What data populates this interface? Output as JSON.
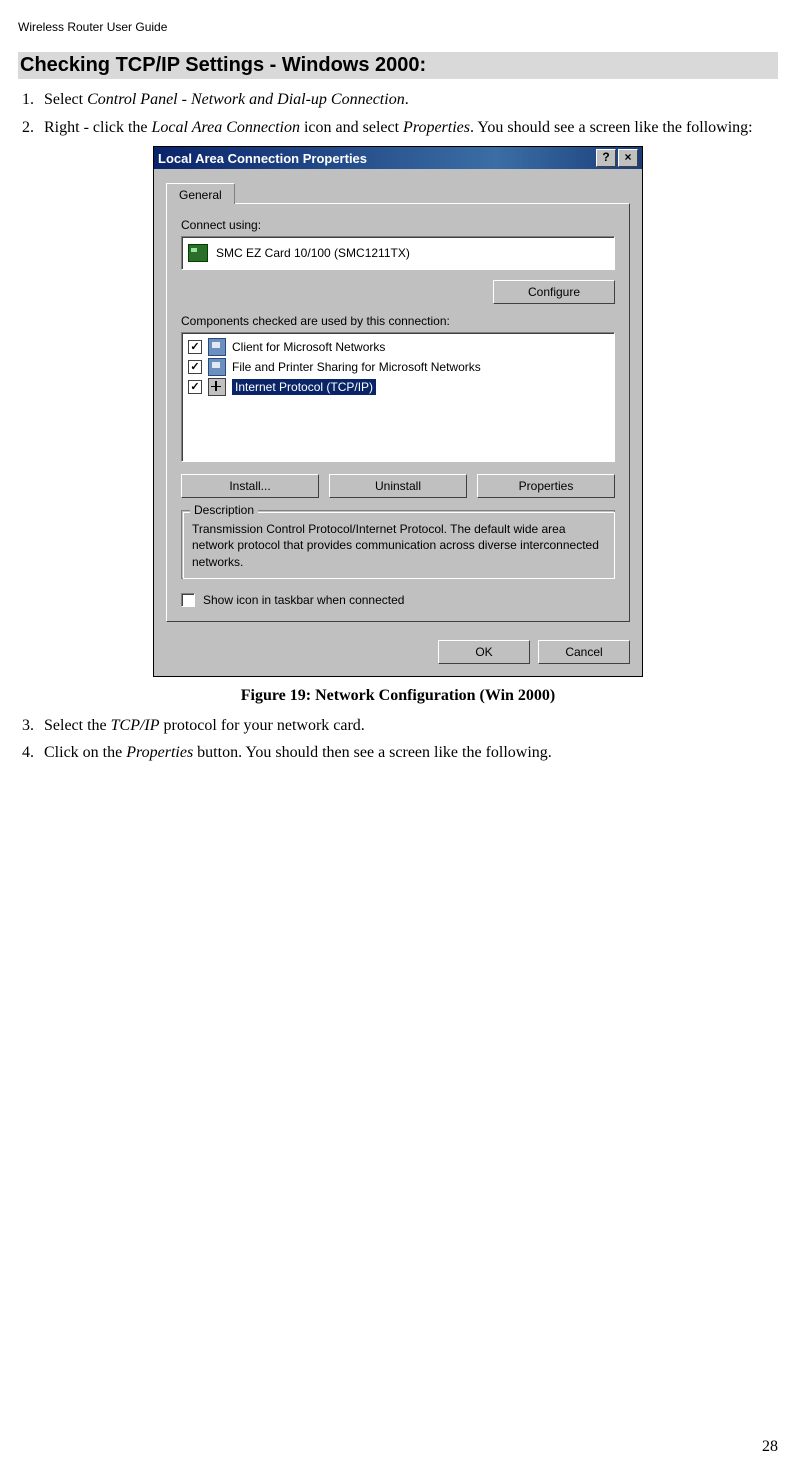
{
  "header": "Wireless Router User Guide",
  "heading": "Checking TCP/IP Settings - Windows 2000:",
  "step1_prefix": "Select ",
  "step1_italic": "Control Panel - Network and Dial-up Connection",
  "step1_suffix": ".",
  "step2_prefix": "Right - click the ",
  "step2_italic1": "Local Area Connection",
  "step2_mid": " icon and select ",
  "step2_italic2": "Properties",
  "step2_suffix": ". You should see a screen like the following:",
  "dialog": {
    "title": "Local Area Connection Properties",
    "help_btn": "?",
    "close_btn": "×",
    "tab": "General",
    "connect_using_label": "Connect using:",
    "adapter": "SMC EZ Card 10/100 (SMC1211TX)",
    "configure_btn": "Configure",
    "components_label": "Components checked are used by this connection:",
    "components": [
      "Client for Microsoft Networks",
      "File and Printer Sharing for Microsoft Networks",
      "Internet Protocol (TCP/IP)"
    ],
    "install_btn": "Install...",
    "uninstall_btn": "Uninstall",
    "properties_btn": "Properties",
    "description_label": "Description",
    "description_text": "Transmission Control Protocol/Internet Protocol. The default wide area network protocol that provides communication across diverse interconnected networks.",
    "show_icon_label": "Show icon in taskbar when connected",
    "ok_btn": "OK",
    "cancel_btn": "Cancel"
  },
  "figure_caption": "Figure 19: Network Configuration (Win 2000)",
  "step3_prefix": "Select the ",
  "step3_italic": "TCP/IP",
  "step3_suffix": " protocol for your network card.",
  "step4_prefix": "Click on the ",
  "step4_italic": "Properties",
  "step4_suffix": " button. You should then see a screen like the following.",
  "page_number": "28"
}
